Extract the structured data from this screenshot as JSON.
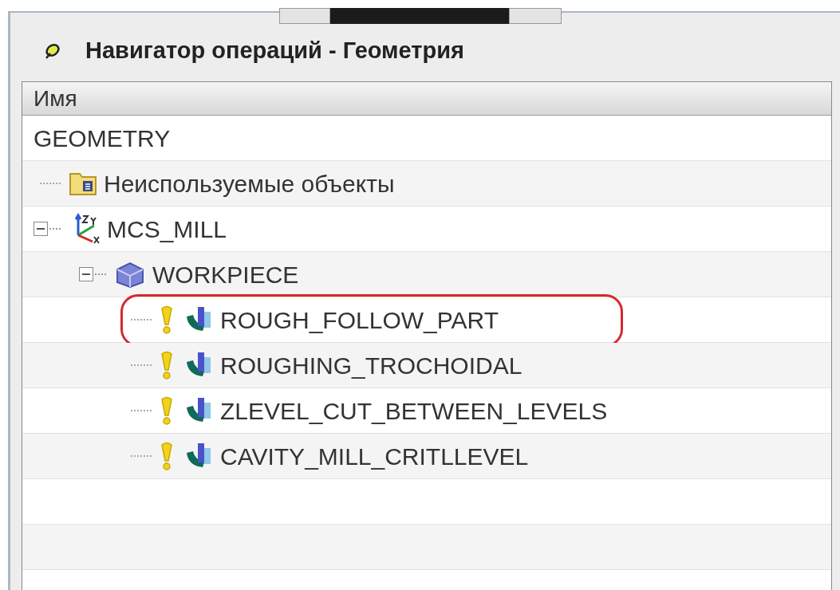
{
  "panel": {
    "title": "Навигатор операций - Геометрия"
  },
  "table": {
    "columns": [
      "Имя"
    ],
    "tree": [
      {
        "label": "GEOMETRY",
        "children": [
          {
            "kind": "folder",
            "label": "Неиспользуемые объекты"
          },
          {
            "kind": "mcs",
            "label": "MCS_MILL",
            "expanded": true,
            "children": [
              {
                "kind": "workpiece",
                "label": "WORKPIECE",
                "expanded": true,
                "children": [
                  {
                    "kind": "operation",
                    "label": "ROUGH_FOLLOW_PART",
                    "highlighted": true
                  },
                  {
                    "kind": "operation",
                    "label": "ROUGHING_TROCHOIDAL",
                    "highlighted": false
                  },
                  {
                    "kind": "operation",
                    "label": "ZLEVEL_CUT_BETWEEN_LEVELS",
                    "highlighted": false
                  },
                  {
                    "kind": "operation",
                    "label": "CAVITY_MILL_CRITLLEVEL",
                    "highlighted": false
                  }
                ]
              }
            ]
          }
        ]
      }
    ]
  }
}
